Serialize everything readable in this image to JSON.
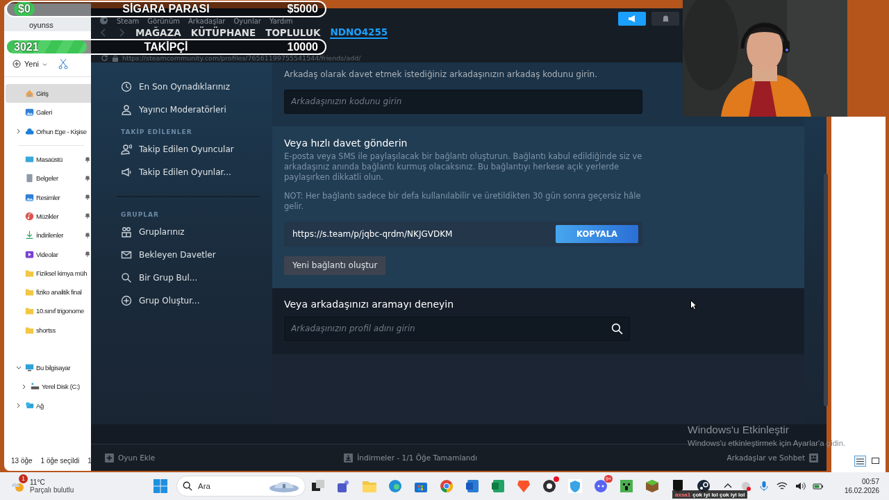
{
  "overlay_goals": [
    {
      "kind": "money",
      "value": "$0",
      "label": "SİGARA PARASI",
      "target": "$5000",
      "level": 0
    },
    {
      "kind": "followers",
      "value": "3021",
      "label": "TAKİPÇİ",
      "target": "10000",
      "level": 0.25
    }
  ],
  "explorer": {
    "title": "oyunss",
    "new_button": "Yeni",
    "quick": [
      {
        "kind": "home",
        "label": "Giriş",
        "selected": true
      },
      {
        "kind": "gallery",
        "label": "Galeri",
        "selected": false
      },
      {
        "kind": "cloud",
        "label": "Orhun Ege - Kişise",
        "selected": false,
        "expanded": false
      }
    ],
    "pinned": [
      {
        "kind": "desktop",
        "label": "Masaüstü",
        "selected": false,
        "pinned": true
      },
      {
        "kind": "documents",
        "label": "Belgeler",
        "selected": false,
        "pinned": true
      },
      {
        "kind": "pictures",
        "label": "Resimler",
        "selected": false,
        "pinned": true
      },
      {
        "kind": "music",
        "label": "Müzikler",
        "selected": false,
        "pinned": true
      },
      {
        "kind": "downloads",
        "label": "İndirilenler",
        "selected": false,
        "pinned": true
      },
      {
        "kind": "videos",
        "label": "Videolar",
        "selected": false,
        "pinned": true
      },
      {
        "kind": "folder",
        "label": "Fiziksel kimya müh",
        "selected": false,
        "pinned": false
      },
      {
        "kind": "folder",
        "label": "fiziko analitik final",
        "selected": false,
        "pinned": false
      },
      {
        "kind": "folder",
        "label": "10.sınıf trigonome",
        "selected": false,
        "pinned": false
      },
      {
        "kind": "folder",
        "label": "shortss",
        "selected": false,
        "pinned": false
      }
    ],
    "tree": [
      {
        "kind": "computer",
        "label": "Bu bilgisayar",
        "selected": false,
        "expanded": true,
        "children": [
          {
            "kind": "disk",
            "label": "Yerel Disk (C:)",
            "selected": false,
            "expanded": false
          }
        ]
      },
      {
        "kind": "network",
        "label": "Ağ",
        "selected": false,
        "expanded": false
      }
    ],
    "status": [
      "13 öğe",
      "1 öğe seçildi",
      "1"
    ]
  },
  "steam": {
    "menu": [
      "Steam",
      "Görünüm",
      "Arkadaşlar",
      "Oyunlar",
      "Yardım"
    ],
    "tabs": [
      {
        "label": "MAĞAZA",
        "selected": false
      },
      {
        "label": "KÜTÜPHANE",
        "selected": false
      },
      {
        "label": "TOPLULUK",
        "selected": false
      },
      {
        "label": "NDNO4255",
        "selected": true
      }
    ],
    "url": "https://steamcommunity.com/profiles/76561199755541544/friends/add/",
    "header_buttons": [
      {
        "kind": "announcement",
        "highlighted": true
      },
      {
        "kind": "notification",
        "highlighted": false
      }
    ],
    "sidebar": [
      {
        "divider_before": false,
        "items": [
          {
            "kind": "clock",
            "label": "En Son Oynadıklarınız"
          },
          {
            "kind": "person",
            "label": "Yayıncı Moderatörleri"
          }
        ]
      },
      {
        "divider_before": false,
        "heading": "TAKİP EDİLENLER",
        "items": [
          {
            "kind": "person-wave",
            "label": "Takip Edilen Oyuncular"
          },
          {
            "kind": "megaphone",
            "label": "Takip Edilen Oyunlar..."
          }
        ]
      },
      {
        "divider_before": true,
        "heading": "GRUPLAR",
        "items": [
          {
            "kind": "group",
            "label": "Gruplarınız"
          },
          {
            "kind": "envelope",
            "label": "Bekleyen Davetler"
          },
          {
            "kind": "search",
            "label": "Bir Grup Bul..."
          },
          {
            "kind": "plus",
            "label": "Grup Oluştur..."
          }
        ]
      }
    ],
    "content": {
      "code_prompt": "Arkadaş olarak davet etmek istediğiniz arkadaşınızın arkadaş kodunu girin.",
      "code_field": {
        "placeholder": "Arkadaşınızın kodunu girin"
      },
      "quick_invite": {
        "title": "Veya hızlı davet gönderin",
        "description": "E-posta veya SMS ile paylaşılacak bir bağlantı oluşturun. Bağlantı kabul edildiğinde siz ve arkadaşınız anında bağlantı kurmuş olacaksınız. Bu bağlantıyı herkese açık yerlerde paylaşırken dikkatli olun.",
        "note": "NOT: Her bağlantı sadece bir defa kullanılabilir ve üretildikten 30 gün sonra geçersiz hâle gelir.",
        "link": "https://s.team/p/jqbc-qrdm/NKJGVDKM",
        "copy_button": "KOPYALA",
        "new_link_button": "Yeni bağlantı oluştur"
      },
      "search": {
        "title": "Veya arkadaşınızı aramayı deneyin",
        "placeholder": "Arkadaşınızın profil adını girin"
      }
    },
    "footer": {
      "add_game": "Oyun Ekle",
      "downloads": "İndirmeler - 1/1 Öğe Tamamlandı",
      "friends": "Arkadaşlar ve Sohbet"
    }
  },
  "file_panel": {
    "views": [
      {
        "kind": "details",
        "selected": true
      },
      {
        "kind": "tiles",
        "selected": false
      }
    ]
  },
  "activation": {
    "title": "Windows'u Etkinleştir",
    "subtitle": "Windows'u etkinleştirmek için Ayarlar'a gidin."
  },
  "taskbar": {
    "weather": {
      "temperature": "11°C",
      "condition": "Parçalı bulutlu",
      "badge": "1"
    },
    "search_placeholder": "Ara",
    "apps": [
      {
        "kind": "taskview"
      },
      {
        "kind": "teams"
      },
      {
        "kind": "files"
      },
      {
        "kind": "edge"
      },
      {
        "kind": "store"
      },
      {
        "kind": "chrome"
      },
      {
        "kind": "word"
      },
      {
        "kind": "excel"
      },
      {
        "kind": "brave"
      },
      {
        "kind": "obs",
        "alert": true
      },
      {
        "kind": "shield"
      },
      {
        "kind": "discord",
        "badge": "9+"
      },
      {
        "kind": "creeper"
      },
      {
        "kind": "grass"
      },
      {
        "kind": "epic"
      },
      {
        "kind": "steam"
      }
    ],
    "clock": {
      "time": "00:57",
      "date": "16.02.2026"
    }
  },
  "chat": {
    "user": "axsa1",
    "message": "çok iyi lol çok iyi lol"
  }
}
